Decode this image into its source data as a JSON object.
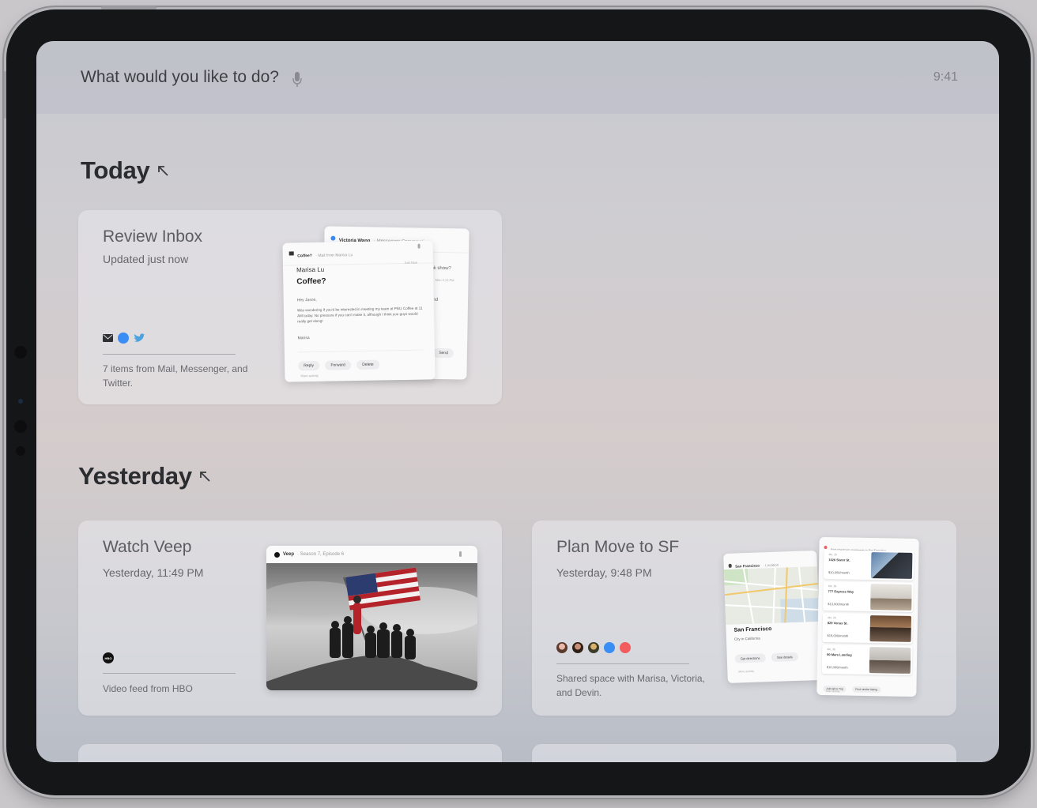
{
  "search": {
    "prompt": "What would you like to do?"
  },
  "status": {
    "time": "9:41"
  },
  "sections": {
    "today": "Today",
    "yesterday": "Yesterday"
  },
  "cards": {
    "inbox": {
      "title": "Review Inbox",
      "subtitle": "Updated just now",
      "footer": "7 items from Mail, Messenger, and Twitter.",
      "icons": [
        "mail-icon",
        "messenger-icon",
        "twitter-icon"
      ],
      "preview": {
        "back_header": "Victoria Wang",
        "back_header_detail": "· Messenger Conversation",
        "back_snippets": [
          "ink show?",
          "Mon 2:13 PM",
          "and",
          "Send"
        ],
        "header": "Coffee?",
        "header_detail": "· Mail from Marisa Lu",
        "time": "Just Now",
        "from": "Marisa Lu",
        "subject": "Coffee?",
        "greeting": "Hey Jason,",
        "body": "Was wondering if you'd be interested in meeting my team at Philz Coffee at 11 AM today. No pressure if you can't make it, although I think you guys would really get along!",
        "signature": "Marisa",
        "actions": [
          "Reply",
          "Forward",
          "Delete"
        ],
        "more": "More activity"
      }
    },
    "veep": {
      "title": "Watch Veep",
      "subtitle": "Yesterday, 11:49 PM",
      "footer": "Video feed from HBO",
      "logo": "HBO",
      "preview": {
        "show": "Veep",
        "episode": "· Season 7, Episode 6"
      }
    },
    "sf": {
      "title": "Plan Move to SF",
      "subtitle": "Yesterday, 9:48 PM",
      "footer": "Shared space with Marisa, Victoria, and Devin.",
      "icons": [
        "avatar-marisa",
        "avatar-victoria",
        "avatar-devin",
        "messenger-icon",
        "airbnb-icon"
      ],
      "map": {
        "header": "San Francisco",
        "header_detail": "· Location",
        "place": "San Francisco",
        "place_sub": "City in California",
        "actions": [
          "Get directions",
          "See details"
        ],
        "more": "More activity"
      },
      "listings": {
        "header": "Find 4 bedroom apartments in San Francisco",
        "items": [
          {
            "unit": "4br, 2b",
            "address": "1026 Sister St.",
            "price": "$10,000/month"
          },
          {
            "unit": "4br, 3b",
            "address": "777 Express Way",
            "price": "$13,000/month"
          },
          {
            "unit": "4br, 3b",
            "address": "829 Venus St.",
            "price": "$15,000/month"
          },
          {
            "unit": "4br, 3b",
            "address": "90 Mars Landing",
            "price": "$10,000/month"
          }
        ],
        "actions": [
          "Add all to Trip",
          "Find similar listing"
        ],
        "more": "More activity"
      }
    }
  }
}
